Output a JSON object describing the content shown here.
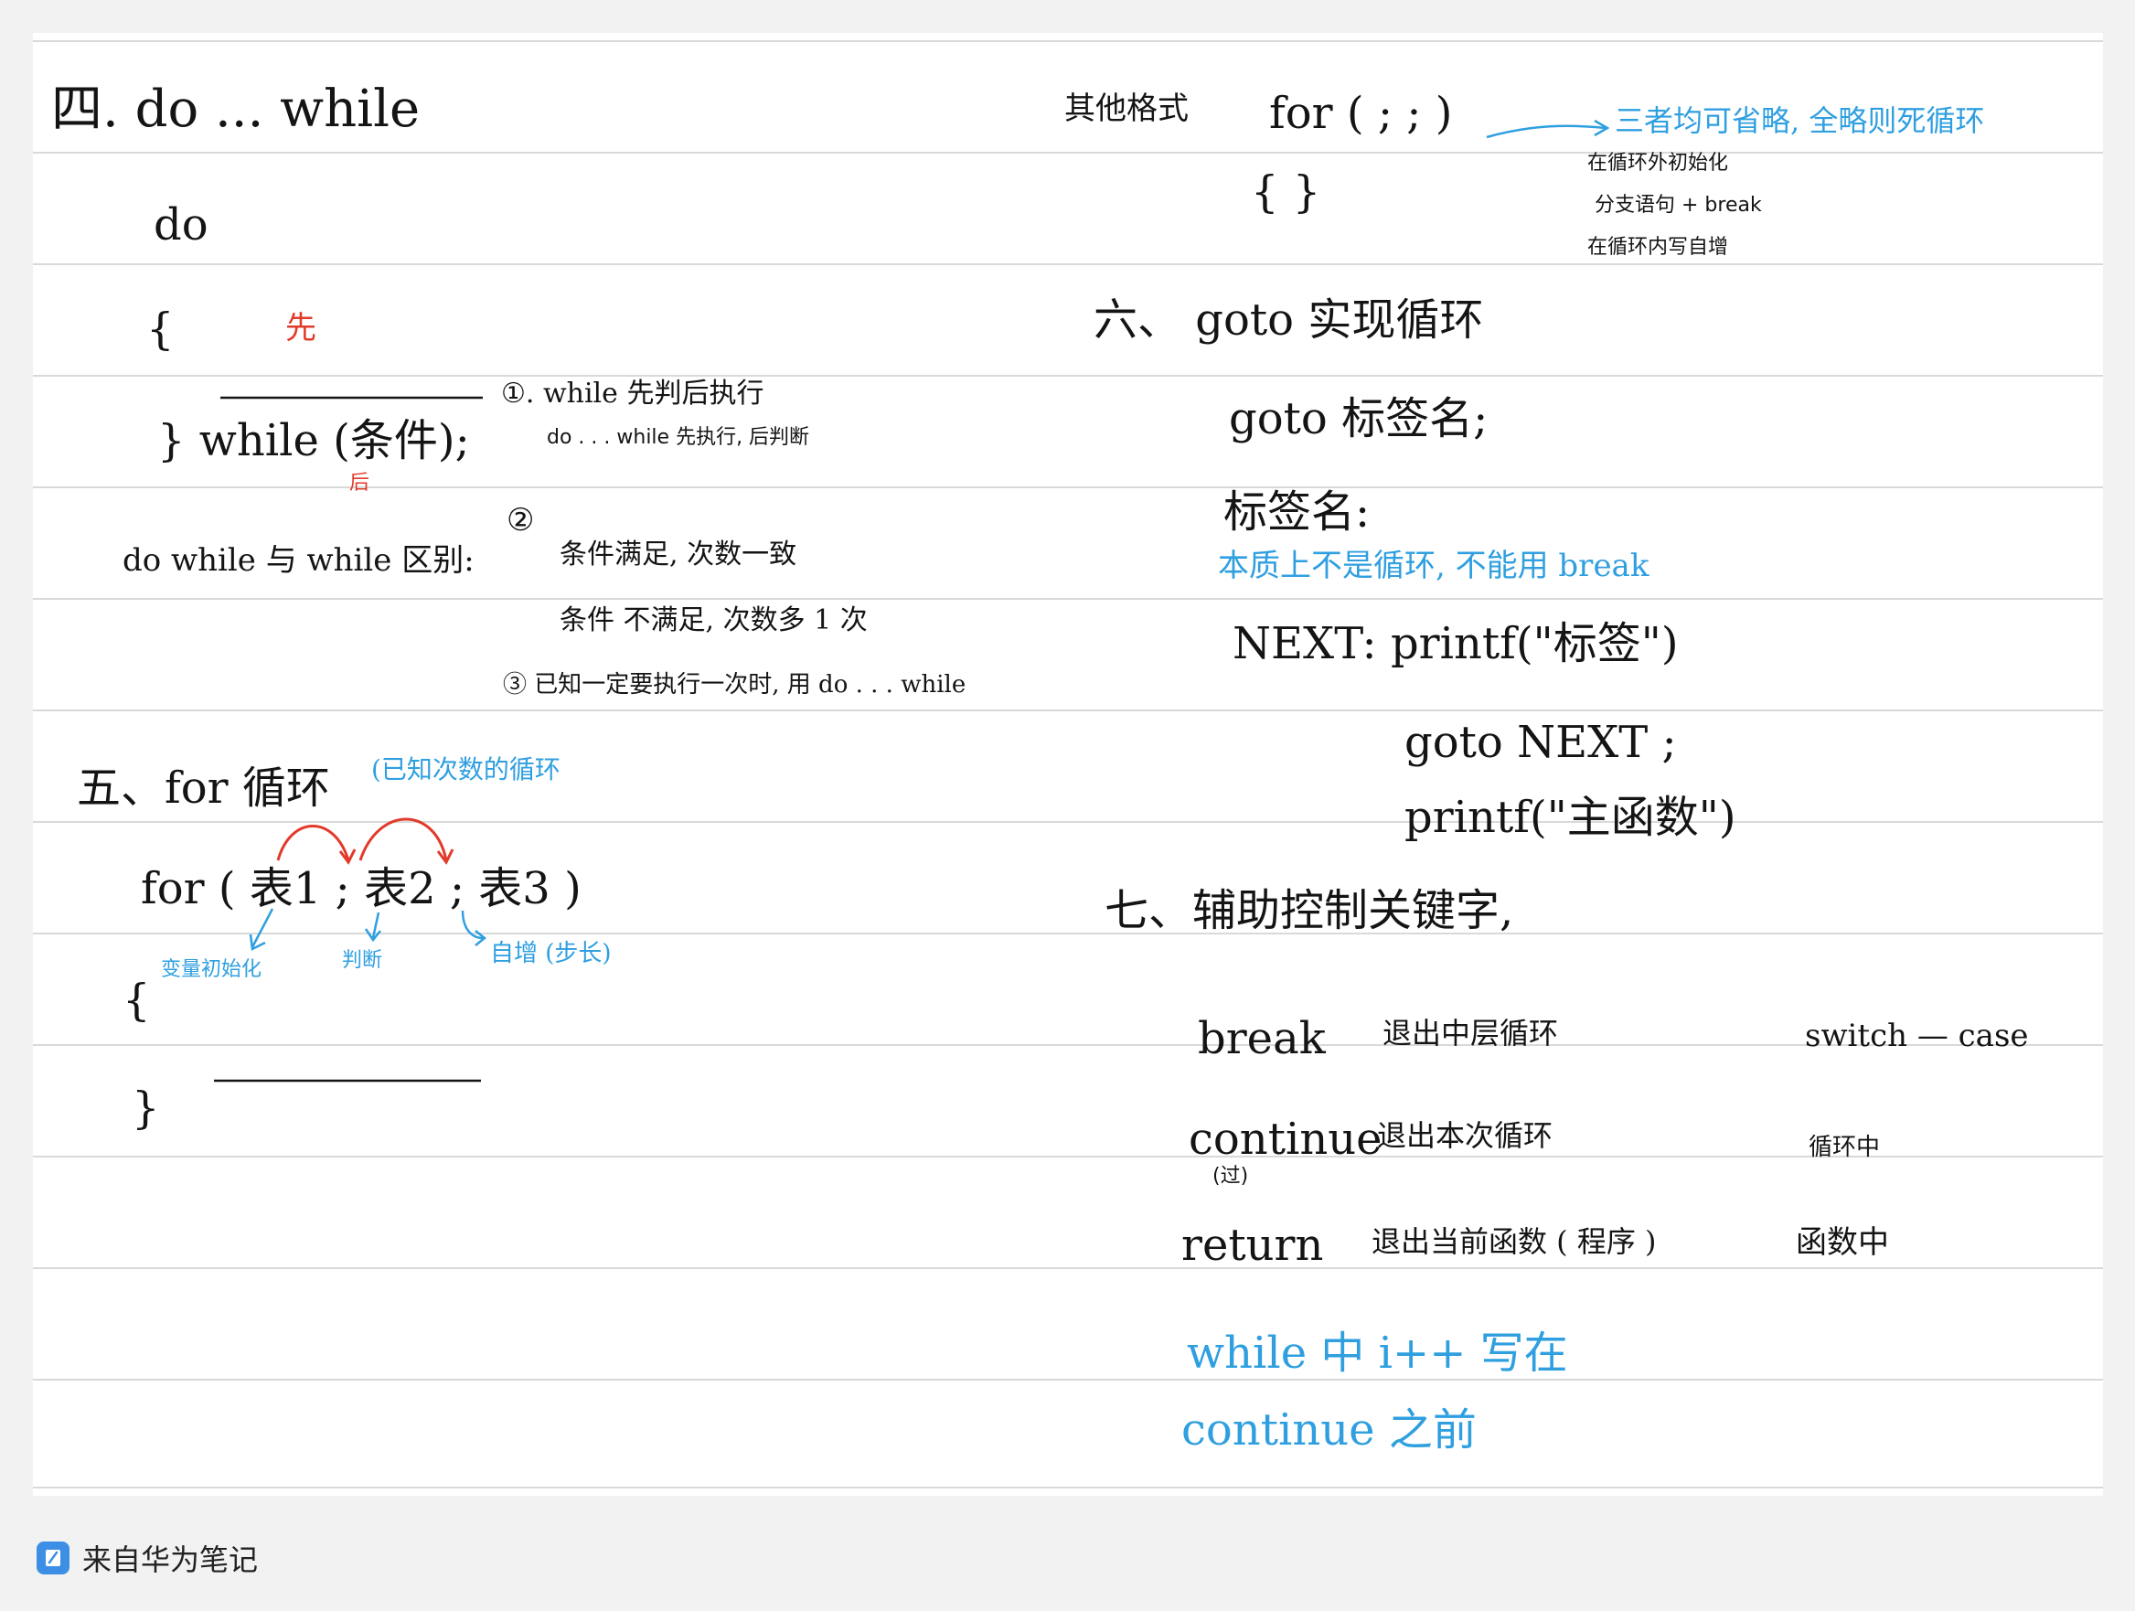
{
  "left": {
    "section4_title": "四. do ... while",
    "do_kw": "do",
    "open_brace": "{",
    "xian": "先",
    "while_cond": "} while (条件);",
    "hou": "后",
    "diff_label": "do while 与 while 区别:",
    "note1_main": "①. while  先判后执行",
    "note1_sub": "do . . . while  先执行, 后判断",
    "note2_num": "②",
    "note2_a": "条件满足, 次数一致",
    "note2_b": "条件 不满足, 次数多 1 次",
    "note3": "③ 已知一定要执行一次时, 用 do . . . while",
    "section5_title": "五、for 循环",
    "section5_note": "(已知次数的循环",
    "for_syntax": "for ( 表1 ; 表2 ; 表3 )",
    "ann_init": "变量初始化",
    "ann_judge": "判断",
    "ann_incr": "自增 (步长)",
    "brace_open2": "{",
    "brace_close2": "}"
  },
  "right": {
    "other_formats": "其他格式",
    "for_empty": "for ( ; ; )",
    "for_braces": "{ }",
    "omit_note": "三者均可省略, 全略则死循环",
    "omit_1": "在循环外初始化",
    "omit_2": "分支语句 + break",
    "omit_3": "在循环内写自增",
    "section6_title": "六、 goto 实现循环",
    "goto_syntax": "goto 标签名;",
    "label_syntax": "标签名:",
    "goto_note": "本质上不是循环, 不能用 break",
    "code_1": "NEXT:  printf(\"标签\")",
    "code_2": "goto NEXT ;",
    "code_3": "printf(\"主函数\")",
    "section7_title": "七、辅助控制关键字,",
    "kw_break": "break",
    "kw_break_desc": "退出中层循环",
    "kw_break_where": "switch — case",
    "kw_continue": "continue",
    "kw_continue_sub": "(过)",
    "kw_continue_desc": "退出本次循环",
    "kw_continue_where": "循环中",
    "kw_return": "return",
    "kw_return_desc": "退出当前函数 ( 程序 )",
    "kw_return_where": "函数中",
    "tip_1": "while 中 i++ 写在",
    "tip_2": "continue 之前"
  },
  "footer": {
    "text": "来自华为笔记",
    "icon": "huawei-notes-icon"
  },
  "colors": {
    "ink": "#141414",
    "blue_ink": "#2f9fe0",
    "red_ink": "#e23a2a",
    "rule": "#d9d9d9",
    "paper": "#ffffff",
    "background": "#f2f2f2"
  }
}
